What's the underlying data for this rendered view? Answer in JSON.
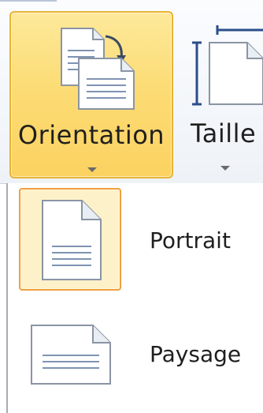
{
  "ribbon": {
    "orientation_label": "Orientation",
    "size_label": "Taille"
  },
  "menu": {
    "items": [
      {
        "label": "Portrait",
        "icon": "portrait-page-icon",
        "selected": true
      },
      {
        "label": "Paysage",
        "icon": "landscape-page-icon",
        "selected": false
      }
    ]
  },
  "colors": {
    "selected_fill": "#fcdc75",
    "selected_border": "#e8b436",
    "item_selected_fill": "#fdf1c9",
    "item_selected_border": "#f0a040"
  }
}
